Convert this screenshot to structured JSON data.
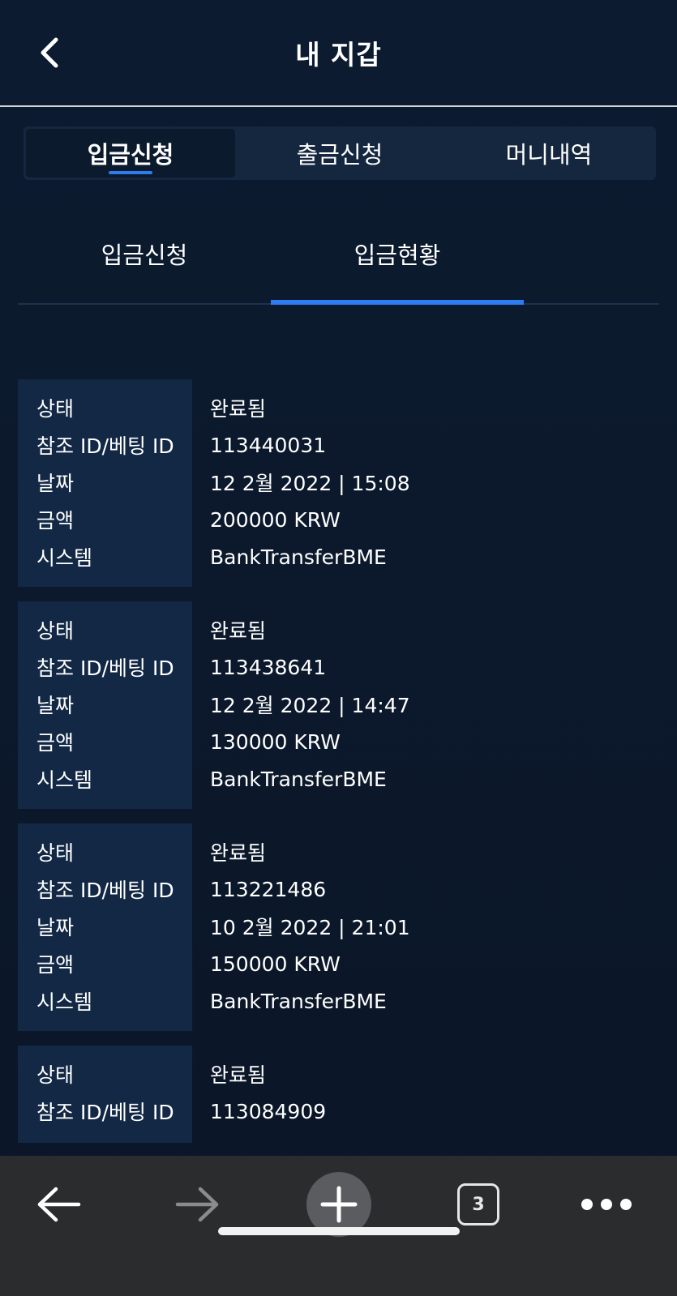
{
  "header": {
    "title": "내 지갑"
  },
  "segment_tabs": [
    {
      "label": "입금신청",
      "active": true
    },
    {
      "label": "출금신청",
      "active": false
    },
    {
      "label": "머니내역",
      "active": false
    }
  ],
  "sub_tabs": [
    {
      "label": "입금신청",
      "active": false
    },
    {
      "label": "입금현황",
      "active": true
    }
  ],
  "labels": {
    "status": "상태",
    "ref_id": "참조 ID/베팅 ID",
    "date": "날짜",
    "amount": "금액",
    "system": "시스템"
  },
  "records": [
    {
      "status": "완료됨",
      "ref_id": "113440031",
      "date": "12 2월 2022 | 15:08",
      "amount": "200000 KRW",
      "system": "BankTransferBME"
    },
    {
      "status": "완료됨",
      "ref_id": "113438641",
      "date": "12 2월 2022 | 14:47",
      "amount": "130000 KRW",
      "system": "BankTransferBME"
    },
    {
      "status": "완료됨",
      "ref_id": "113221486",
      "date": "10 2월 2022 | 21:01",
      "amount": "150000 KRW",
      "system": "BankTransferBME"
    },
    {
      "status": "완료됨",
      "ref_id": "113084909"
    }
  ],
  "toolbar": {
    "tab_count": "3",
    "icons": [
      "back-arrow-icon",
      "forward-arrow-icon",
      "plus-icon",
      "tabs-icon",
      "more-icon"
    ]
  },
  "colors": {
    "background": "#0c1a2e",
    "accent": "#2f7cf0",
    "label_column": "#122845",
    "toolbar": "#2b2c2e"
  }
}
